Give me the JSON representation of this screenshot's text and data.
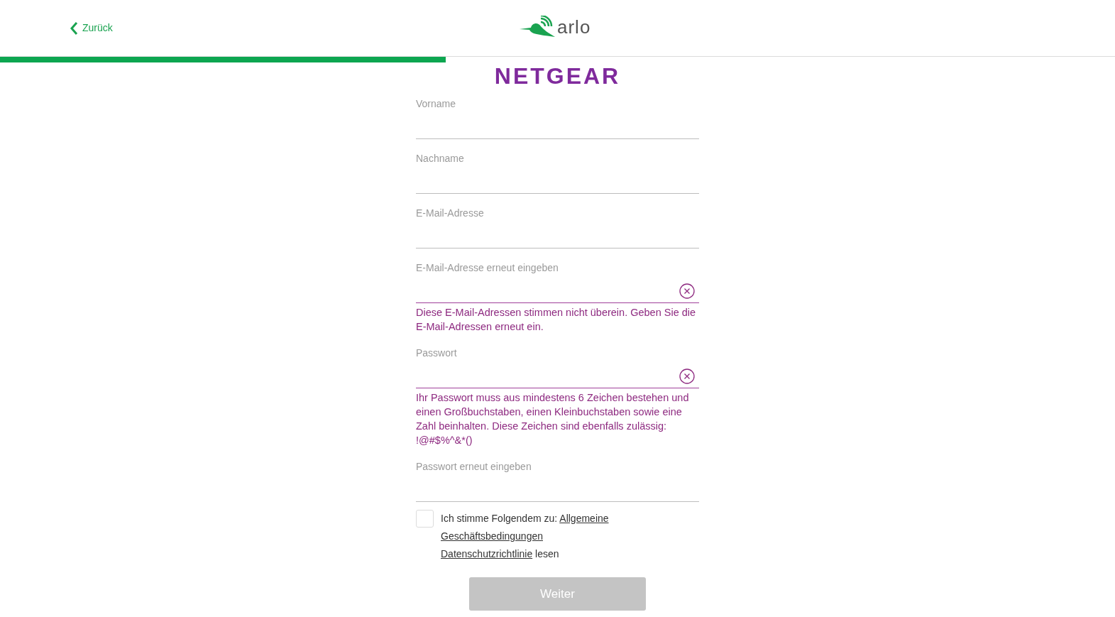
{
  "header": {
    "back_link": "Zurück",
    "logo_text": "arlo"
  },
  "progress": {
    "level": 0.4
  },
  "brand": "NETGEAR",
  "fields": [
    {
      "label": "Vorname",
      "invalid": false
    },
    {
      "label": "Nachname",
      "invalid": false
    },
    {
      "label": "E-Mail-Adresse",
      "invalid": false
    },
    {
      "label": "E-Mail-Adresse erneut eingeben",
      "invalid": true,
      "error": "Diese E-Mail-Adressen stimmen nicht überein. Geben Sie die E-Mail-Adressen erneut ein."
    },
    {
      "label": "Passwort",
      "invalid": true,
      "error": "Ihr Passwort muss aus mindestens 6 Zeichen bestehen und einen Großbuchstaben, einen Kleinbuchstaben sowie eine Zahl beinhalten. Diese Zeichen sind ebenfalls zulässig: !@#$%^&*()"
    },
    {
      "label": "Passwort erneut eingeben",
      "invalid": false
    }
  ],
  "terms": {
    "checked": false,
    "lines": [
      [
        {
          "kind": "text",
          "text": "Ich stimme Folgendem zu: "
        },
        {
          "kind": "link",
          "text": "Allgemeine"
        }
      ],
      [
        {
          "kind": "link",
          "text": "Geschäftsbedingungen"
        }
      ],
      [
        {
          "kind": "link",
          "text": "Datenschutzrichtlinie"
        },
        {
          "kind": "text",
          "text": " lesen"
        }
      ]
    ]
  },
  "submit": {
    "label": "Weiter",
    "disabled": true
  }
}
